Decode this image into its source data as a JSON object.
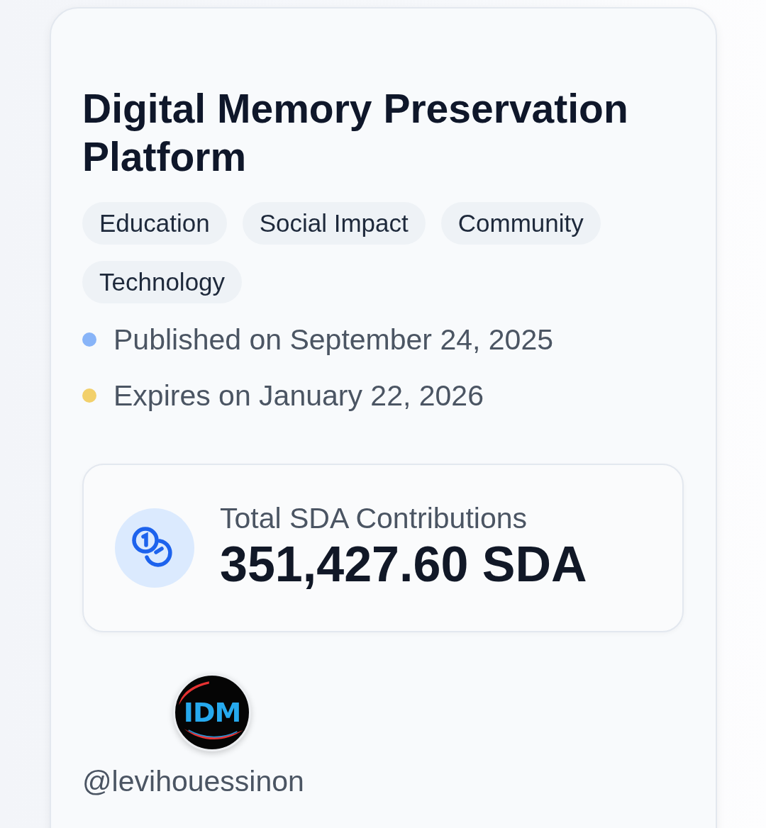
{
  "title": "Digital Memory Preservation Platform",
  "tags": [
    {
      "label": "Education"
    },
    {
      "label": "Social Impact"
    },
    {
      "label": "Community"
    },
    {
      "label": "Technology"
    }
  ],
  "dates": [
    {
      "text": "Published on September 24, 2025",
      "color": "#88b4f8"
    },
    {
      "text": "Expires on January 22, 2026",
      "color": "#f2d06b"
    }
  ],
  "contributions": {
    "label": "Total SDA Contributions",
    "value": "351,427.60 SDA"
  },
  "creator": {
    "avatar_text": "IDM",
    "handle": "@levihouessinon"
  }
}
